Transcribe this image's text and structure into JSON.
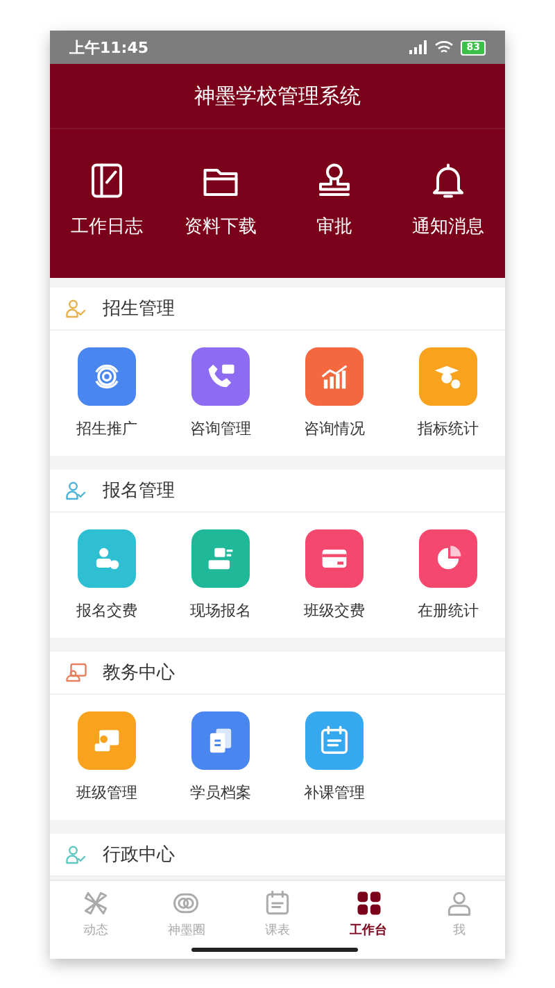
{
  "status_bar": {
    "time": "上午11:45",
    "battery": "83"
  },
  "header": {
    "title": "神墨学校管理系统",
    "shortcuts": [
      {
        "label": "工作日志",
        "kind": "notebook"
      },
      {
        "label": "资料下载",
        "kind": "folder"
      },
      {
        "label": "审批",
        "kind": "stamp"
      },
      {
        "label": "通知消息",
        "kind": "bell"
      }
    ]
  },
  "sections": [
    {
      "title": "招生管理",
      "kind": "people",
      "color": "#e8b04a",
      "items": [
        {
          "label": "招生推广",
          "kind": "target",
          "color": "#4a86f0"
        },
        {
          "label": "咨询管理",
          "kind": "phone",
          "color": "#8e6cf2"
        },
        {
          "label": "咨询情况",
          "kind": "bars",
          "color": "#f4673f"
        },
        {
          "label": "指标统计",
          "kind": "graduate",
          "color": "#f8a21d"
        }
      ]
    },
    {
      "title": "报名管理",
      "kind": "people",
      "color": "#4ab2d6",
      "items": [
        {
          "label": "报名交费",
          "kind": "person-coin",
          "color": "#2fbfd3"
        },
        {
          "label": "现场报名",
          "kind": "person-form",
          "color": "#1fb99a"
        },
        {
          "label": "班级交费",
          "kind": "card",
          "color": "#f5486e"
        },
        {
          "label": "在册统计",
          "kind": "pie",
          "color": "#f5486e"
        }
      ]
    },
    {
      "title": "教务中心",
      "kind": "board-outline",
      "color": "#e58060",
      "items": [
        {
          "label": "班级管理",
          "kind": "board",
          "color": "#f8a21d"
        },
        {
          "label": "学员档案",
          "kind": "docs",
          "color": "#4a86f0"
        },
        {
          "label": "补课管理",
          "kind": "calendar",
          "color": "#36a8f0"
        }
      ]
    },
    {
      "title": "行政中心",
      "kind": "people",
      "color": "#5cc6c0"
    }
  ],
  "tab_bar": [
    {
      "label": "动态",
      "kind": "pinwheel",
      "selected": false
    },
    {
      "label": "神墨圈",
      "kind": "circles",
      "selected": false
    },
    {
      "label": "课表",
      "kind": "calendar",
      "selected": false
    },
    {
      "label": "工作台",
      "kind": "grid",
      "selected": true
    },
    {
      "label": "我",
      "kind": "user",
      "selected": false
    }
  ]
}
